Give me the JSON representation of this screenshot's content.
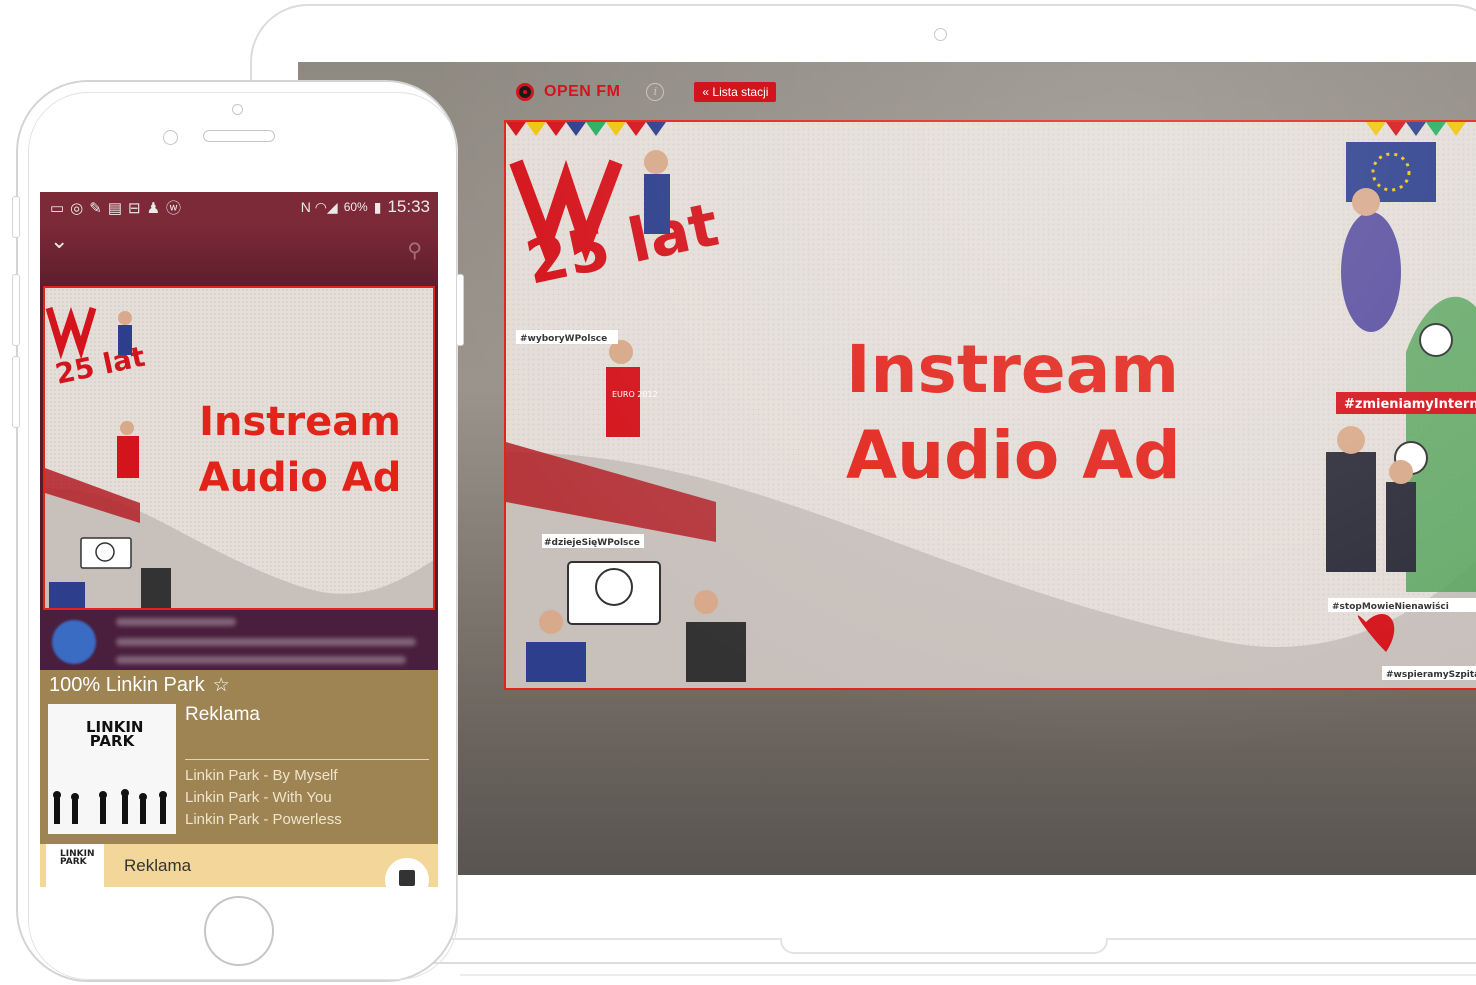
{
  "desktop": {
    "brand": "OPEN FM",
    "info_icon": "info-icon",
    "station_list_button": "« Lista stacji",
    "ad": {
      "line1": "Instream",
      "line2": "Audio Ad"
    },
    "hashtags": [
      "#wyboryWPolsce",
      "#dziejeSięWPolsce",
      "#zmieniamyInternet",
      "#stopMowieNienawiści",
      "#wspieramySzpitale"
    ],
    "artwork_text": {
      "anniversary": "25 lat",
      "badge": "EURO 2012"
    }
  },
  "phone": {
    "status_bar": {
      "battery": "60%",
      "time": "15:33"
    },
    "ad": {
      "line1": "Instream",
      "line2": "Audio Ad"
    },
    "player": {
      "station": "100% Linkin Park",
      "now_playing": "Reklama",
      "album_logo": "LINKIN PARK",
      "tracks": [
        "Linkin Park - By Myself",
        "Linkin Park - With You",
        "Linkin Park - Powerless"
      ]
    },
    "mini_player": {
      "title": "Reklama"
    }
  },
  "colors": {
    "accent": "#e2231a",
    "player_bg": "#9e8453",
    "mini_player_bg": "#f3d79a"
  }
}
